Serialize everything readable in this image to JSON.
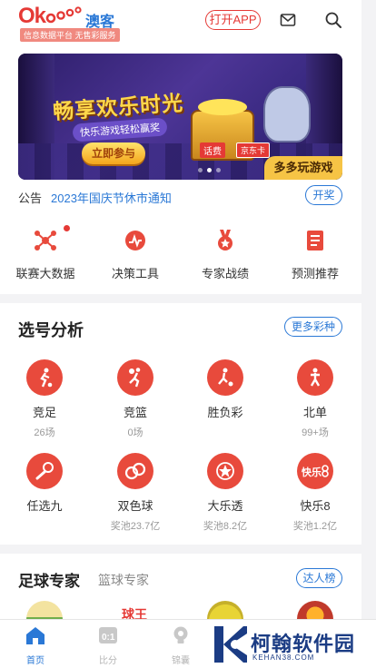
{
  "header": {
    "logo_text": "Okooo",
    "brand_name": "澳客",
    "slogan": "信息数据平台 无售彩服务",
    "open_app_label": "打开APP",
    "mail_icon": "mail-icon",
    "search_icon": "search-icon"
  },
  "banner": {
    "title": "畅享欢乐时光",
    "subtitle": "快乐游戏轻松赢奖",
    "cta_label": "立即参与",
    "corner_label": "多多玩游戏",
    "tag_1": "话费",
    "tag_2": "京东卡",
    "slide_count": 3,
    "active_slide": 1
  },
  "notice": {
    "label": "公告",
    "text": "2023年国庆节休市通知",
    "button_label": "开奖"
  },
  "quick_links": [
    {
      "label": "联赛大数据",
      "icon": "network-icon",
      "badge_dot": true
    },
    {
      "label": "决策工具",
      "icon": "chart-pulse-icon",
      "badge_dot": false
    },
    {
      "label": "专家战绩",
      "icon": "medal-icon",
      "badge_dot": false
    },
    {
      "label": "预测推荐",
      "icon": "document-icon",
      "badge_dot": false
    }
  ],
  "lottery_section": {
    "title": "选号分析",
    "more_label": "更多彩种",
    "items": [
      {
        "name": "竞足",
        "meta": "26场",
        "icon": "football-player-icon"
      },
      {
        "name": "竞篮",
        "meta": "0场",
        "icon": "basketball-player-icon"
      },
      {
        "name": "胜负彩",
        "meta": "",
        "icon": "soccer-kick-icon"
      },
      {
        "name": "北单",
        "meta": "99+场",
        "icon": "athlete-icon"
      },
      {
        "name": "任选九",
        "meta": "",
        "icon": "soccer-ball-icon"
      },
      {
        "name": "双色球",
        "meta": "奖池23.7亿",
        "icon": "double-ball-icon"
      },
      {
        "name": "大乐透",
        "meta": "奖池8.2亿",
        "icon": "star-icon"
      },
      {
        "name": "快乐8",
        "meta": "奖池1.2亿",
        "icon": "kuaile8-icon"
      }
    ]
  },
  "expert_section": {
    "tab_main": "足球专家",
    "tab_sub": "篮球专家",
    "ranking_label": "达人榜",
    "avatar_text": "球王"
  },
  "bottom_nav": [
    {
      "label": "首页",
      "icon": "home-icon",
      "active": true
    },
    {
      "label": "比分",
      "icon": "scoreboard-icon",
      "active": false
    },
    {
      "label": "锦囊",
      "icon": "lightbulb-icon",
      "active": false
    }
  ],
  "watermark": {
    "title": "柯翰软件园",
    "url": "KEHAN38.COM"
  },
  "colors": {
    "brand_red": "#e53935",
    "link_blue": "#2a78d6",
    "icon_red": "#e84a3c"
  }
}
